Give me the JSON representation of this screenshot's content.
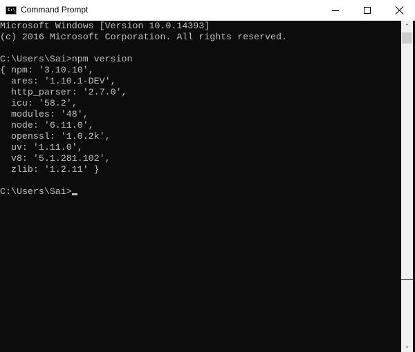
{
  "window": {
    "title": "Command Prompt",
    "icon_label": "C:\\_",
    "icon": "cmd-icon",
    "buttons": {
      "minimize": "minimize-icon",
      "maximize": "maximize-icon",
      "close": "close-icon"
    }
  },
  "console": {
    "lines": [
      "Microsoft Windows [Version 10.0.14393]",
      "(c) 2016 Microsoft Corporation. All rights reserved.",
      "",
      "C:\\Users\\Sai>npm version",
      "{ npm: '3.10.10',",
      "  ares: '1.10.1-DEV',",
      "  http_parser: '2.7.0',",
      "  icu: '58.2',",
      "  modules: '48',",
      "  node: '6.11.0',",
      "  openssl: '1.0.2k',",
      "  uv: '1.11.0',",
      "  v8: '5.1.281.102',",
      "  zlib: '1.2.11' }",
      ""
    ],
    "prompt": "C:\\Users\\Sai>",
    "colors": {
      "background": "#0c0c0c",
      "foreground": "#c0c0c0"
    }
  },
  "scrollbar": {
    "up_glyph": "⌃",
    "down_glyph": "⌄"
  }
}
